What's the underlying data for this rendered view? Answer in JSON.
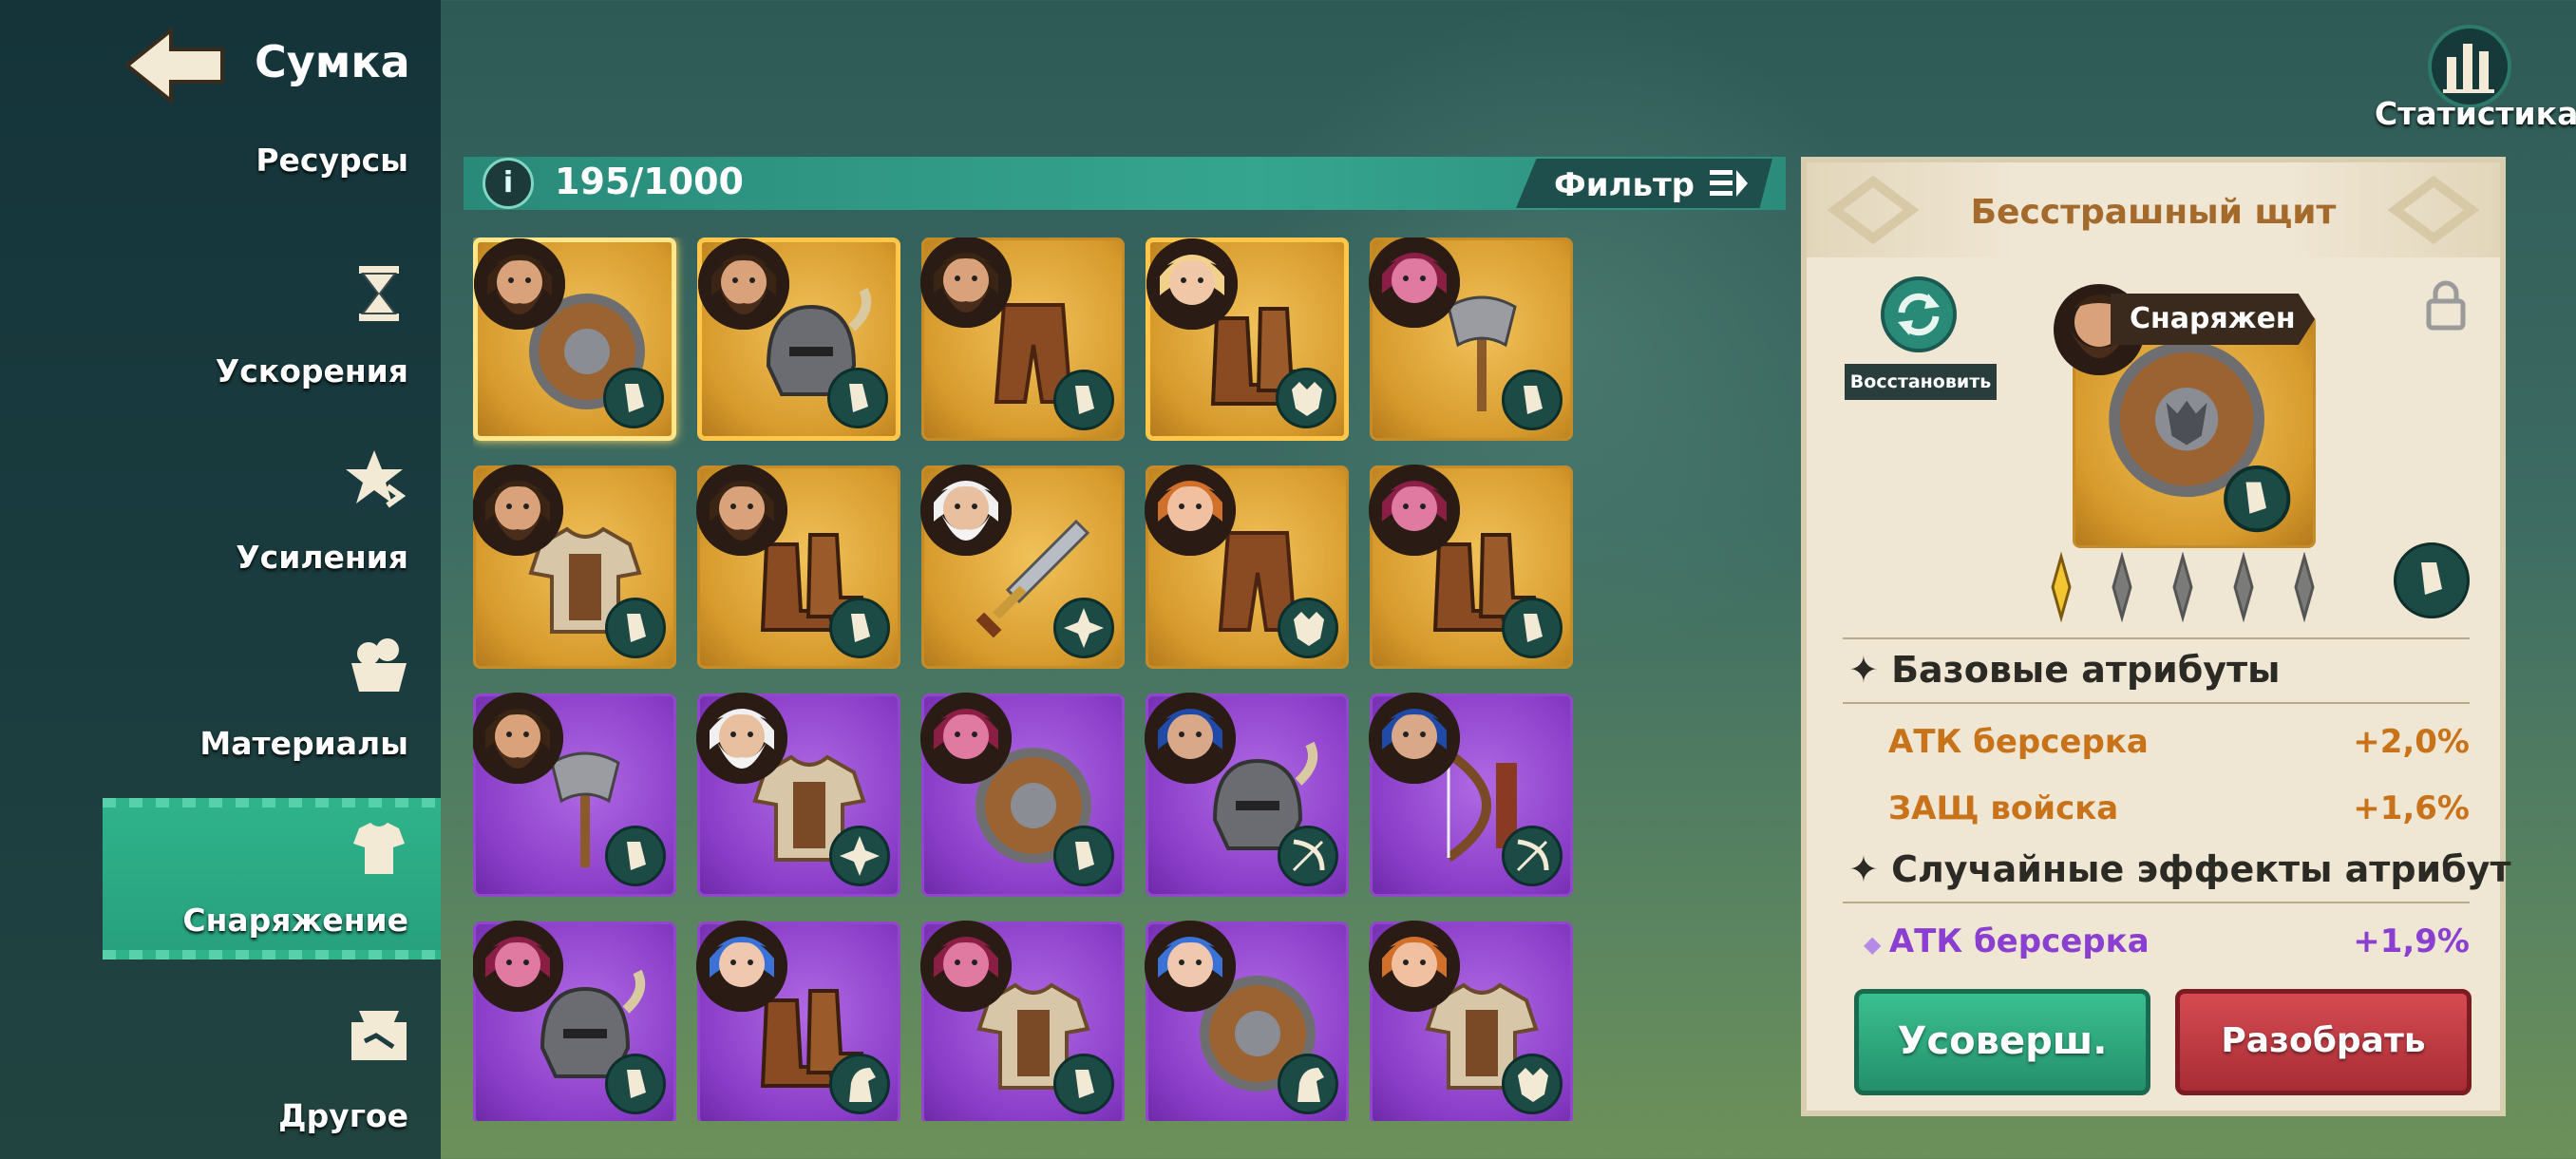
{
  "header": {
    "title": "Сумка"
  },
  "sidebar": {
    "items": [
      {
        "label": "Ресурсы"
      },
      {
        "label": "Ускорения"
      },
      {
        "label": "Усиления"
      },
      {
        "label": "Материалы"
      },
      {
        "label": "Снаряжение"
      },
      {
        "label": "Другое"
      }
    ]
  },
  "toolbar": {
    "info_icon": "i",
    "capacity": "195/1000",
    "filter_label": "Фильтр"
  },
  "stats": {
    "label": "Статистика"
  },
  "grid": {
    "items": [
      {
        "rarity": "gold",
        "hero": "dwarf",
        "icon": "shield-icon",
        "badge": "boot-icon"
      },
      {
        "rarity": "gold",
        "hero": "dwarf",
        "icon": "helmet-icon",
        "badge": "boot-icon"
      },
      {
        "rarity": "gold",
        "hero": "dwarf",
        "icon": "pants-icon",
        "badge": "boot-icon"
      },
      {
        "rarity": "gold",
        "hero": "blonde",
        "icon": "boots-icon",
        "badge": "wolf-icon"
      },
      {
        "rarity": "gold",
        "hero": "pink-elf",
        "icon": "axe-icon",
        "badge": "boot-icon"
      },
      {
        "rarity": "gold",
        "hero": "dwarf",
        "icon": "chest-armor-icon",
        "badge": "boot-icon"
      },
      {
        "rarity": "gold",
        "hero": "dwarf",
        "icon": "boots-icon",
        "badge": "boot-icon"
      },
      {
        "rarity": "gold",
        "hero": "old-king",
        "icon": "sword-icon",
        "badge": "shuriken-icon"
      },
      {
        "rarity": "gold",
        "hero": "ginger",
        "icon": "pants-icon",
        "badge": "wolf-icon"
      },
      {
        "rarity": "gold",
        "hero": "pink-elf",
        "icon": "boots-icon",
        "badge": "boot-icon"
      },
      {
        "rarity": "purple",
        "hero": "dwarf",
        "icon": "axe-icon",
        "badge": "boot-icon"
      },
      {
        "rarity": "purple",
        "hero": "old-king",
        "icon": "chest-armor-icon",
        "badge": "shuriken-icon"
      },
      {
        "rarity": "purple",
        "hero": "pink-elf",
        "icon": "shield-icon",
        "badge": "boot-icon"
      },
      {
        "rarity": "purple",
        "hero": "blue-hair",
        "icon": "helmet-icon",
        "badge": "bow-icon"
      },
      {
        "rarity": "purple",
        "hero": "blue-hair",
        "icon": "bow-icon",
        "badge": "bow-icon"
      },
      {
        "rarity": "purple",
        "hero": "pink-elf",
        "icon": "helmet-icon",
        "badge": "boot-icon"
      },
      {
        "rarity": "purple",
        "hero": "blue-elf",
        "icon": "boots-icon",
        "badge": "horse-icon"
      },
      {
        "rarity": "purple",
        "hero": "pink-elf",
        "icon": "chest-armor-icon",
        "badge": "boot-icon"
      },
      {
        "rarity": "purple",
        "hero": "blue-elf",
        "icon": "shield-icon",
        "badge": "horse-icon"
      },
      {
        "rarity": "purple",
        "hero": "ginger",
        "icon": "chest-armor-icon",
        "badge": "wolf-icon"
      }
    ]
  },
  "detail": {
    "title": "Бесстрашный щит",
    "restore_label": "Восстановить",
    "equipped_label": "Снаряжен",
    "stars": {
      "filled": 1,
      "total": 5
    },
    "base_section": "Базовые атрибуты",
    "base_attrs": [
      {
        "name": "АТК берсерка",
        "value": "+2,0%"
      },
      {
        "name": "ЗАЩ войска",
        "value": "+1,6%"
      }
    ],
    "random_section": "Случайные эффекты атрибут",
    "random_attrs": [
      {
        "name": "АТК берсерка",
        "value": "+1,9%"
      }
    ],
    "upgrade_label": "Усоверш.",
    "disassemble_label": "Разобрать"
  },
  "colors": {
    "accent_green": "#2fb38b",
    "gold_tile": "#d79a2c",
    "purple_tile": "#8a3dc8",
    "attr_orange": "#c8731a",
    "attr_purple": "#8a3fd0",
    "button_red": "#c0393f"
  }
}
